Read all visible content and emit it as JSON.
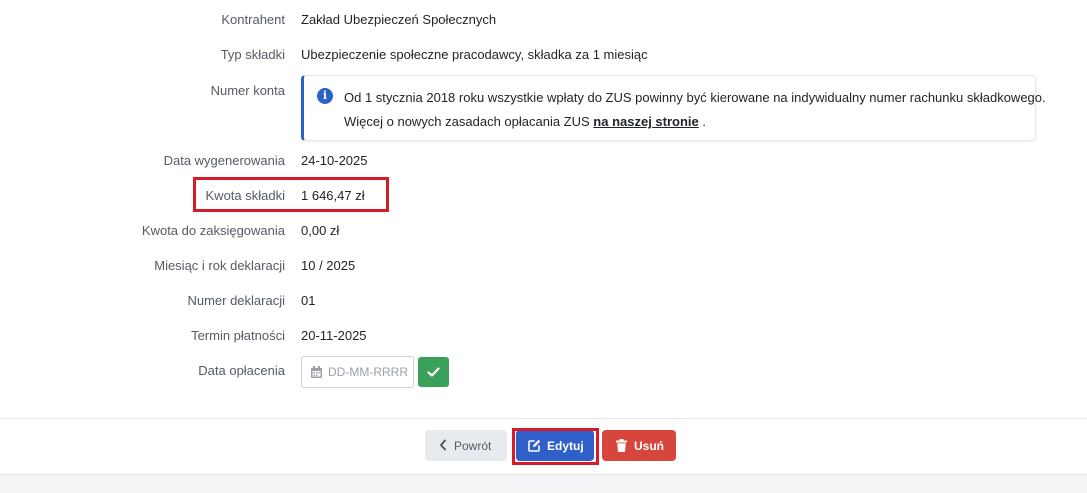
{
  "fields": {
    "kontrahent": {
      "label": "Kontrahent",
      "value": "Zakład Ubezpieczeń Społecznych"
    },
    "typ": {
      "label": "Typ składki",
      "value": "Ubezpieczenie społeczne pracodawcy, składka za 1 miesiąc"
    },
    "numer_konta": {
      "label": "Numer konta"
    },
    "data_wyg": {
      "label": "Data wygenerowania",
      "value": "24-10-2025"
    },
    "kwota": {
      "label": "Kwota składki",
      "value": "1 646,47 zł"
    },
    "kwota_zaks": {
      "label": "Kwota do zaksięgowania",
      "value": "0,00 zł"
    },
    "miesiac": {
      "label": "Miesiąc i rok deklaracji",
      "value": "10 / 2025"
    },
    "numer_dekl": {
      "label": "Numer deklaracji",
      "value": "01"
    },
    "termin": {
      "label": "Termin płatności",
      "value": "20-11-2025"
    },
    "data_opl": {
      "label": "Data opłacenia",
      "placeholder": "DD-MM-RRRR",
      "value": ""
    }
  },
  "info": {
    "icon": "info-icon",
    "line1": "Od 1 stycznia 2018 roku wszystkie wpłaty do ZUS powinny być kierowane na indywidualny numer rachunku składkowego.",
    "line2_prefix": "Więcej o nowych zasadach opłacania ZUS ",
    "link_text": "na naszej stronie",
    "line2_suffix": " ."
  },
  "buttons": {
    "back": {
      "label": "Powrót",
      "icon": "chevron-left-icon"
    },
    "edit": {
      "label": "Edytuj",
      "icon": "edit-icon"
    },
    "delete": {
      "label": "Usuń",
      "icon": "trash-icon"
    }
  },
  "colors": {
    "primary": "#2f5fc9",
    "success": "#3aa05a",
    "danger": "#d6463c",
    "highlight": "#d81b2a"
  }
}
